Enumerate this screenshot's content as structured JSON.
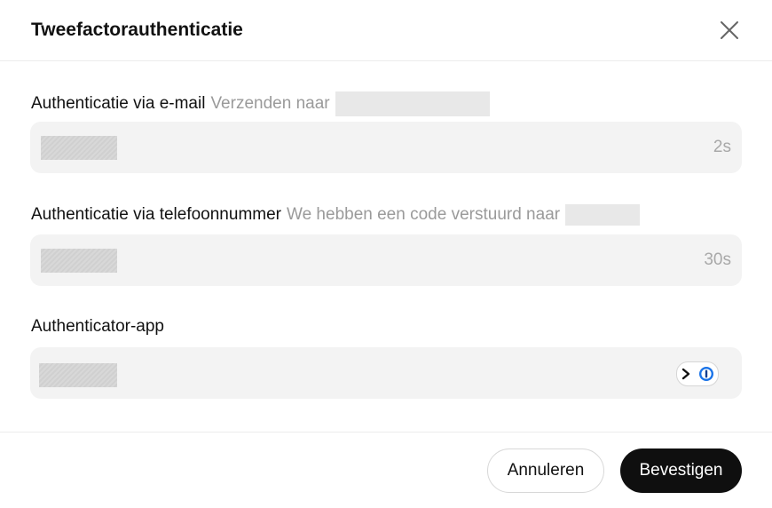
{
  "dialog": {
    "title": "Tweefactorauthenticatie",
    "close_icon": "close-icon"
  },
  "email": {
    "label": "Authenticatie via e-mail",
    "hint": "Verzenden naar",
    "timer": "2s",
    "value": ""
  },
  "phone": {
    "label": "Authenticatie via telefoonnummer",
    "hint": "We hebben een code verstuurd naar",
    "timer": "30s",
    "value": ""
  },
  "app": {
    "label": "Authenticator-app",
    "value": "",
    "icons": [
      "chevron-right-icon",
      "password-manager-icon"
    ]
  },
  "footer": {
    "cancel_label": "Annuleren",
    "confirm_label": "Bevestigen"
  },
  "colors": {
    "primary_button": "#0f0f0f",
    "field_bg": "#f3f3f3",
    "hint_text": "#9a9a9a",
    "password_manager_accent": "#1a73e8"
  }
}
